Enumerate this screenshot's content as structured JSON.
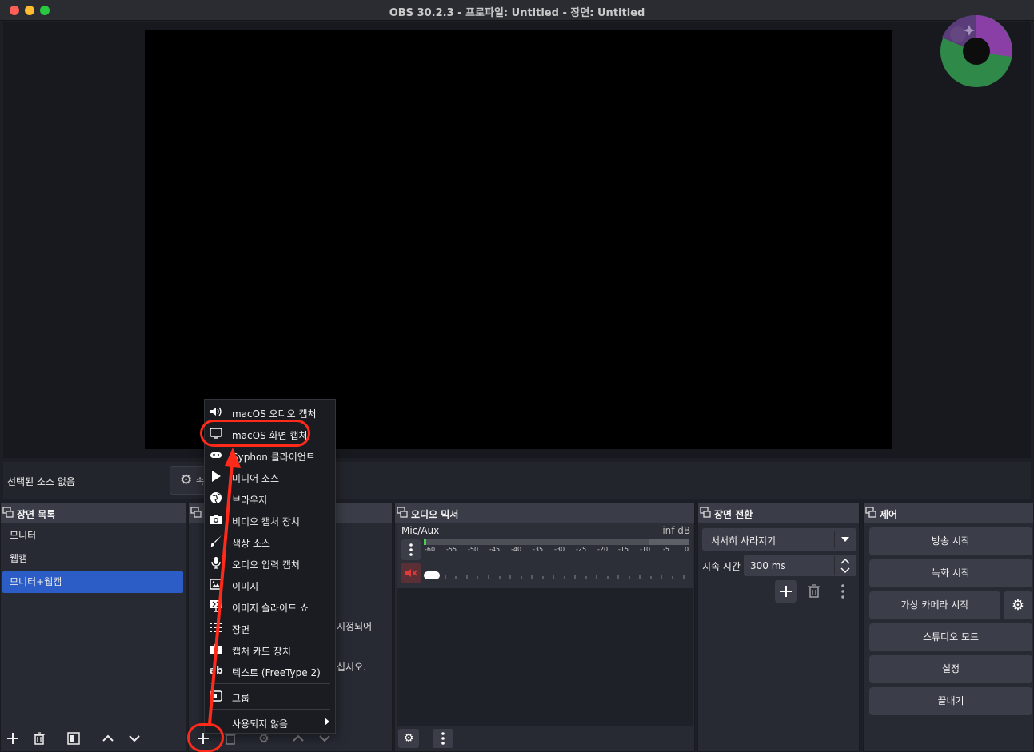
{
  "window": {
    "title": "OBS 30.2.3 - 프로파일: Untitled - 장면: Untitled"
  },
  "source_bar": {
    "no_source_label": "선택된 소스 없음",
    "properties_label": "속"
  },
  "scenes_dock": {
    "title": "장면 목록",
    "items": [
      "모니터",
      "웹캠",
      "모니터+웹캠"
    ],
    "active_index": 2
  },
  "sources_dock": {
    "hidden_text_1": "지정되어",
    "hidden_text_2": "십시오."
  },
  "context_menu": {
    "items": [
      {
        "icon": "speaker-icon",
        "label": "macOS 오디오 캡처"
      },
      {
        "icon": "monitor-icon",
        "label": "macOS 화면 캡처"
      },
      {
        "icon": "gamepad-icon",
        "label": "Syphon 클라이언트"
      },
      {
        "icon": "play-icon",
        "label": "미디어 소스"
      },
      {
        "icon": "globe-icon",
        "label": "브라우저"
      },
      {
        "icon": "camera-icon",
        "label": "비디오 캡처 장치"
      },
      {
        "icon": "brush-icon",
        "label": "색상 소스"
      },
      {
        "icon": "microphone-icon",
        "label": "오디오 입력 캡처"
      },
      {
        "icon": "image-icon",
        "label": "이미지"
      },
      {
        "icon": "slideshow-icon",
        "label": "이미지 슬라이드 쇼"
      },
      {
        "icon": "list-icon",
        "label": "장면"
      },
      {
        "icon": "capture-card-icon",
        "label": "캡처 카드 장치"
      },
      {
        "icon": "text-icon",
        "label": "텍스트 (FreeType 2)"
      }
    ],
    "group_label": "그룹",
    "deprecated_label": "사용되지 않음"
  },
  "audio_mixer": {
    "title": "오디오 믹서",
    "channel_name": "Mic/Aux",
    "level": "-inf dB",
    "scale_ticks": [
      "-60",
      "-55",
      "-50",
      "-45",
      "-40",
      "-35",
      "-30",
      "-25",
      "-20",
      "-15",
      "-10",
      "-5",
      "0"
    ]
  },
  "transitions": {
    "title": "장면 전환",
    "selected": "서서히 사라지기",
    "duration_label": "지속 시간",
    "duration_value": "300 ms"
  },
  "controls": {
    "title": "제어",
    "buttons": [
      "방송 시작",
      "녹화 시작",
      "가상 카메라 시작",
      "스튜디오 모드",
      "설정",
      "끝내기"
    ]
  },
  "colors": {
    "accent": "#2c5cc5",
    "annotation": "#ff2a1a",
    "logo_purple": "#8a3fa6",
    "logo_green": "#2f8a4a"
  }
}
